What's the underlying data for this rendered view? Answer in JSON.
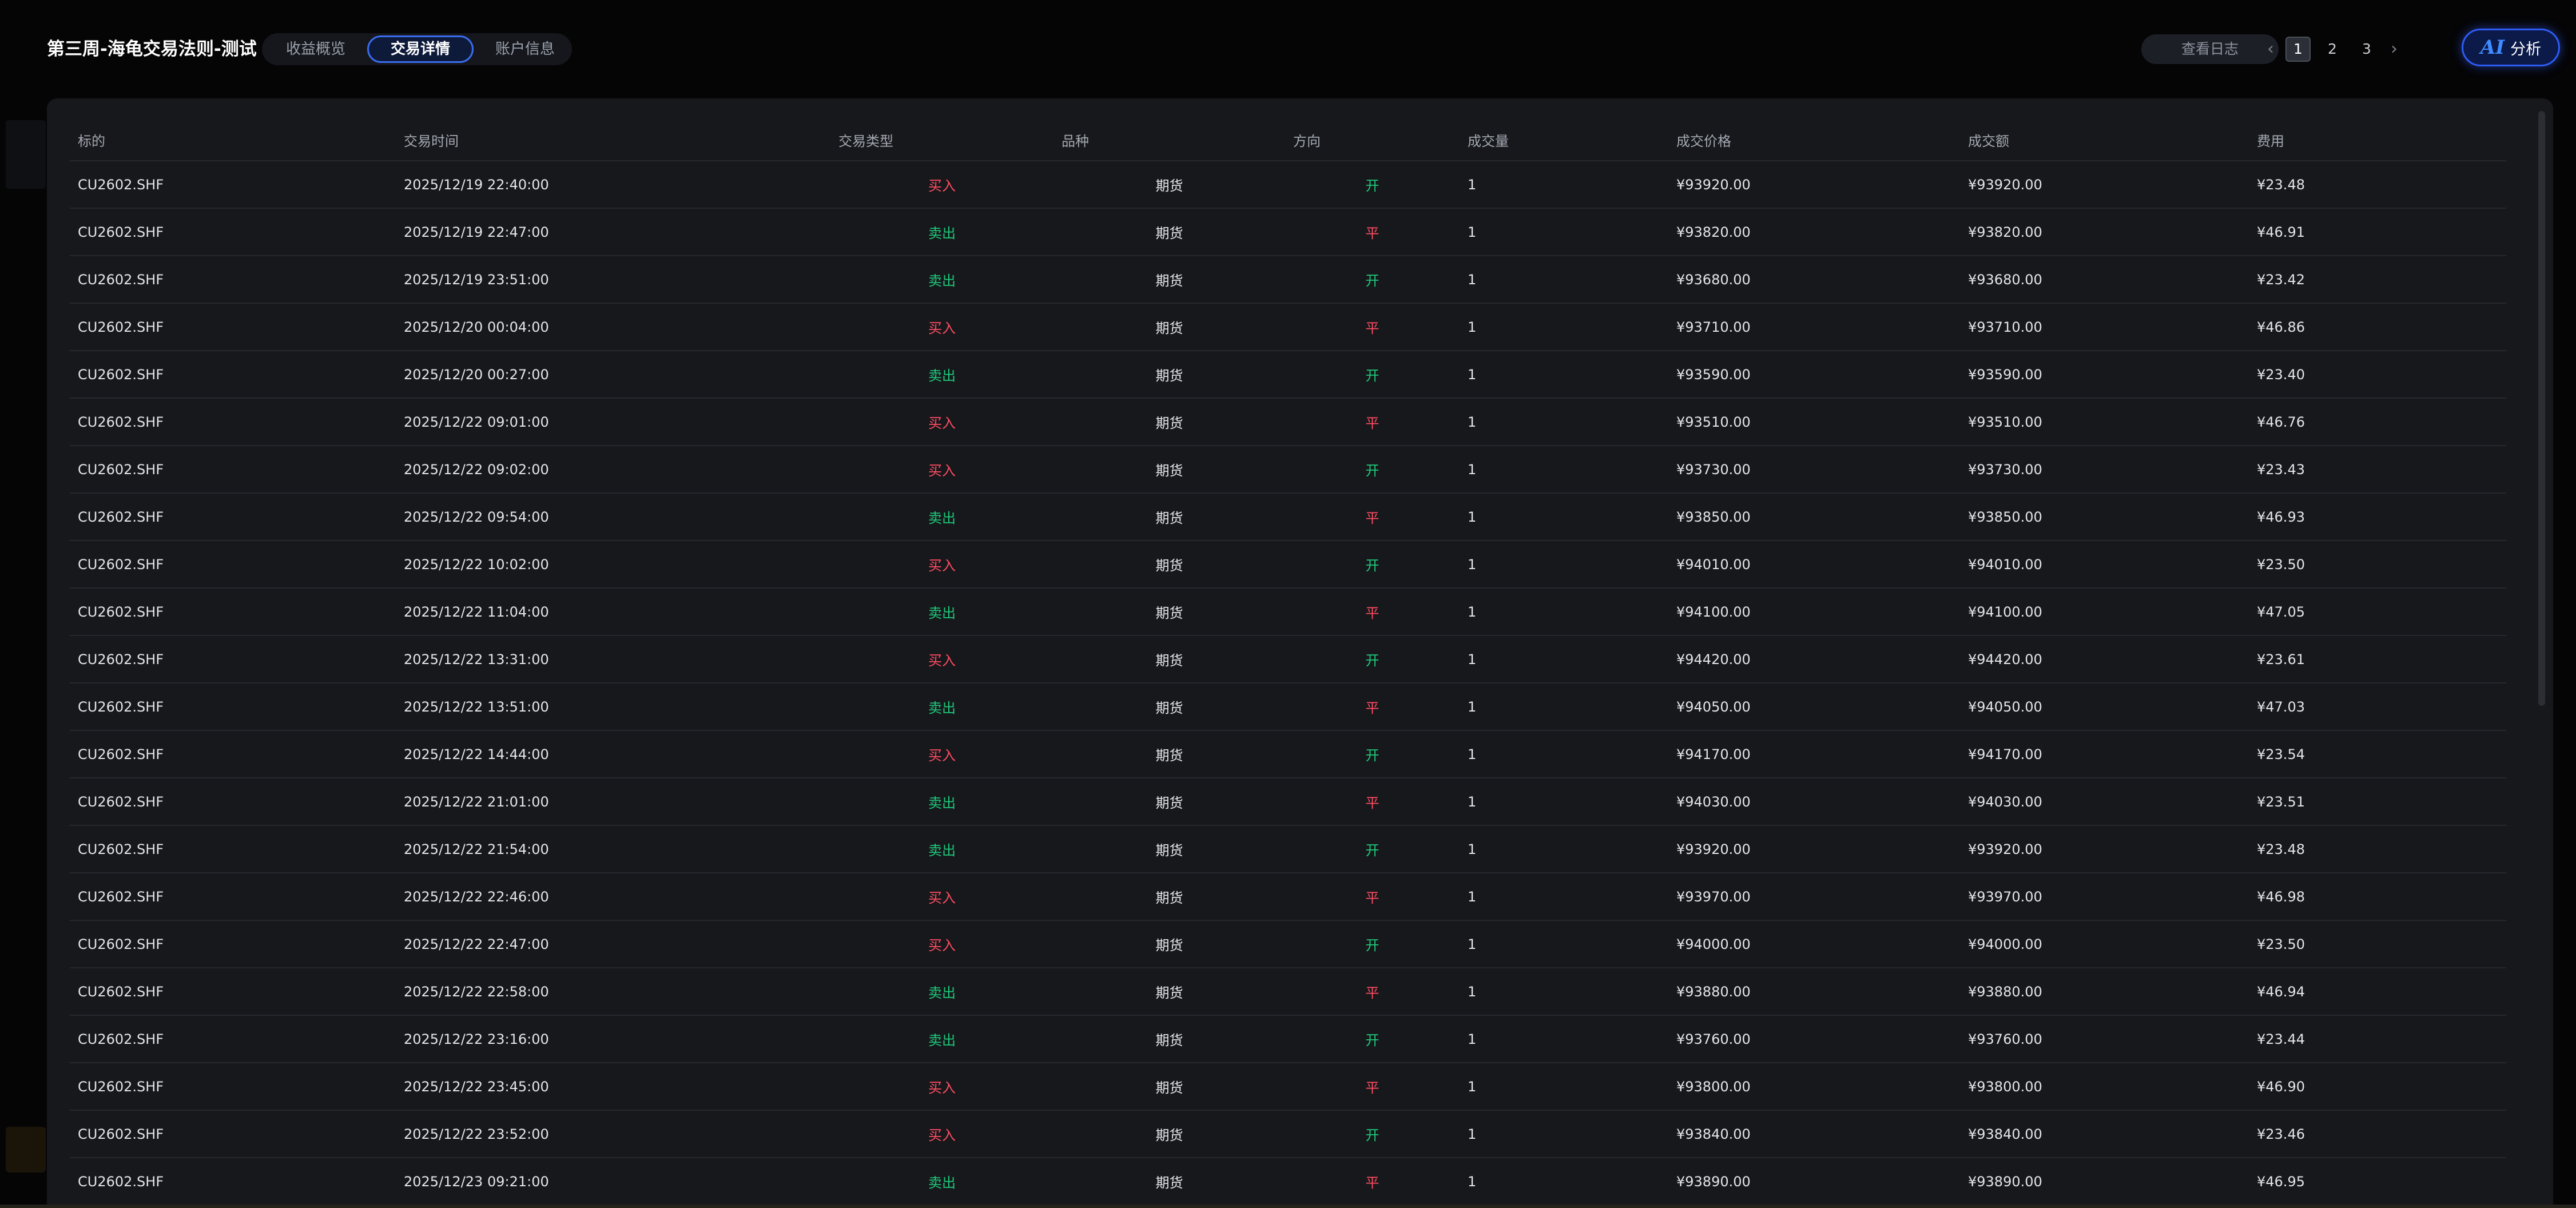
{
  "header": {
    "title": "第三周-海龟交易法则-测试",
    "tabs": [
      {
        "label": "收益概览",
        "active": false
      },
      {
        "label": "交易详情",
        "active": true
      },
      {
        "label": "账户信息",
        "active": false
      }
    ],
    "log_button": "查看日志",
    "pagination": {
      "prev": "‹",
      "next": "›",
      "pages": [
        "1",
        "2",
        "3"
      ],
      "current": "1"
    },
    "ai_button": {
      "icon_text": "AI",
      "label": "分析"
    }
  },
  "colors": {
    "buy": "#ff4d62",
    "sell": "#1fc97a",
    "accent": "#2f5cf5"
  },
  "table": {
    "columns": [
      "标的",
      "交易时间",
      "交易类型",
      "品种",
      "方向",
      "成交量",
      "成交价格",
      "成交额",
      "费用"
    ],
    "rows": [
      [
        "CU2602.SHF",
        "2025/12/19 22:40:00",
        "买入",
        "期货",
        "开",
        "1",
        "¥93920.00",
        "¥93920.00",
        "¥23.48"
      ],
      [
        "CU2602.SHF",
        "2025/12/19 22:47:00",
        "卖出",
        "期货",
        "平",
        "1",
        "¥93820.00",
        "¥93820.00",
        "¥46.91"
      ],
      [
        "CU2602.SHF",
        "2025/12/19 23:51:00",
        "卖出",
        "期货",
        "开",
        "1",
        "¥93680.00",
        "¥93680.00",
        "¥23.42"
      ],
      [
        "CU2602.SHF",
        "2025/12/20 00:04:00",
        "买入",
        "期货",
        "平",
        "1",
        "¥93710.00",
        "¥93710.00",
        "¥46.86"
      ],
      [
        "CU2602.SHF",
        "2025/12/20 00:27:00",
        "卖出",
        "期货",
        "开",
        "1",
        "¥93590.00",
        "¥93590.00",
        "¥23.40"
      ],
      [
        "CU2602.SHF",
        "2025/12/22 09:01:00",
        "买入",
        "期货",
        "平",
        "1",
        "¥93510.00",
        "¥93510.00",
        "¥46.76"
      ],
      [
        "CU2602.SHF",
        "2025/12/22 09:02:00",
        "买入",
        "期货",
        "开",
        "1",
        "¥93730.00",
        "¥93730.00",
        "¥23.43"
      ],
      [
        "CU2602.SHF",
        "2025/12/22 09:54:00",
        "卖出",
        "期货",
        "平",
        "1",
        "¥93850.00",
        "¥93850.00",
        "¥46.93"
      ],
      [
        "CU2602.SHF",
        "2025/12/22 10:02:00",
        "买入",
        "期货",
        "开",
        "1",
        "¥94010.00",
        "¥94010.00",
        "¥23.50"
      ],
      [
        "CU2602.SHF",
        "2025/12/22 11:04:00",
        "卖出",
        "期货",
        "平",
        "1",
        "¥94100.00",
        "¥94100.00",
        "¥47.05"
      ],
      [
        "CU2602.SHF",
        "2025/12/22 13:31:00",
        "买入",
        "期货",
        "开",
        "1",
        "¥94420.00",
        "¥94420.00",
        "¥23.61"
      ],
      [
        "CU2602.SHF",
        "2025/12/22 13:51:00",
        "卖出",
        "期货",
        "平",
        "1",
        "¥94050.00",
        "¥94050.00",
        "¥47.03"
      ],
      [
        "CU2602.SHF",
        "2025/12/22 14:44:00",
        "买入",
        "期货",
        "开",
        "1",
        "¥94170.00",
        "¥94170.00",
        "¥23.54"
      ],
      [
        "CU2602.SHF",
        "2025/12/22 21:01:00",
        "卖出",
        "期货",
        "平",
        "1",
        "¥94030.00",
        "¥94030.00",
        "¥23.51"
      ],
      [
        "CU2602.SHF",
        "2025/12/22 21:54:00",
        "卖出",
        "期货",
        "开",
        "1",
        "¥93920.00",
        "¥93920.00",
        "¥23.48"
      ],
      [
        "CU2602.SHF",
        "2025/12/22 22:46:00",
        "买入",
        "期货",
        "平",
        "1",
        "¥93970.00",
        "¥93970.00",
        "¥46.98"
      ],
      [
        "CU2602.SHF",
        "2025/12/22 22:47:00",
        "买入",
        "期货",
        "开",
        "1",
        "¥94000.00",
        "¥94000.00",
        "¥23.50"
      ],
      [
        "CU2602.SHF",
        "2025/12/22 22:58:00",
        "卖出",
        "期货",
        "平",
        "1",
        "¥93880.00",
        "¥93880.00",
        "¥46.94"
      ],
      [
        "CU2602.SHF",
        "2025/12/22 23:16:00",
        "卖出",
        "期货",
        "开",
        "1",
        "¥93760.00",
        "¥93760.00",
        "¥23.44"
      ],
      [
        "CU2602.SHF",
        "2025/12/22 23:45:00",
        "买入",
        "期货",
        "平",
        "1",
        "¥93800.00",
        "¥93800.00",
        "¥46.90"
      ],
      [
        "CU2602.SHF",
        "2025/12/22 23:52:00",
        "买入",
        "期货",
        "开",
        "1",
        "¥93840.00",
        "¥93840.00",
        "¥23.46"
      ],
      [
        "CU2602.SHF",
        "2025/12/23 09:21:00",
        "卖出",
        "期货",
        "平",
        "1",
        "¥93890.00",
        "¥93890.00",
        "¥46.95"
      ]
    ]
  }
}
